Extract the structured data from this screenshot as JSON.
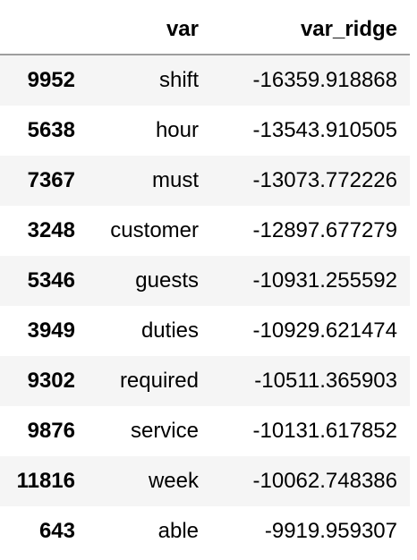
{
  "table": {
    "columns": [
      "",
      "var",
      "var_ridge"
    ],
    "rows": [
      {
        "index": "9952",
        "var": "shift",
        "var_ridge": "-16359.918868"
      },
      {
        "index": "5638",
        "var": "hour",
        "var_ridge": "-13543.910505"
      },
      {
        "index": "7367",
        "var": "must",
        "var_ridge": "-13073.772226"
      },
      {
        "index": "3248",
        "var": "customer",
        "var_ridge": "-12897.677279"
      },
      {
        "index": "5346",
        "var": "guests",
        "var_ridge": "-10931.255592"
      },
      {
        "index": "3949",
        "var": "duties",
        "var_ridge": "-10929.621474"
      },
      {
        "index": "9302",
        "var": "required",
        "var_ridge": "-10511.365903"
      },
      {
        "index": "9876",
        "var": "service",
        "var_ridge": "-10131.617852"
      },
      {
        "index": "11816",
        "var": "week",
        "var_ridge": "-10062.748386"
      },
      {
        "index": "643",
        "var": "able",
        "var_ridge": "-9919.959307"
      }
    ]
  },
  "colors": {
    "stripe": "#f5f5f5",
    "header_rule": "#9e9e9e",
    "text": "#000000"
  }
}
